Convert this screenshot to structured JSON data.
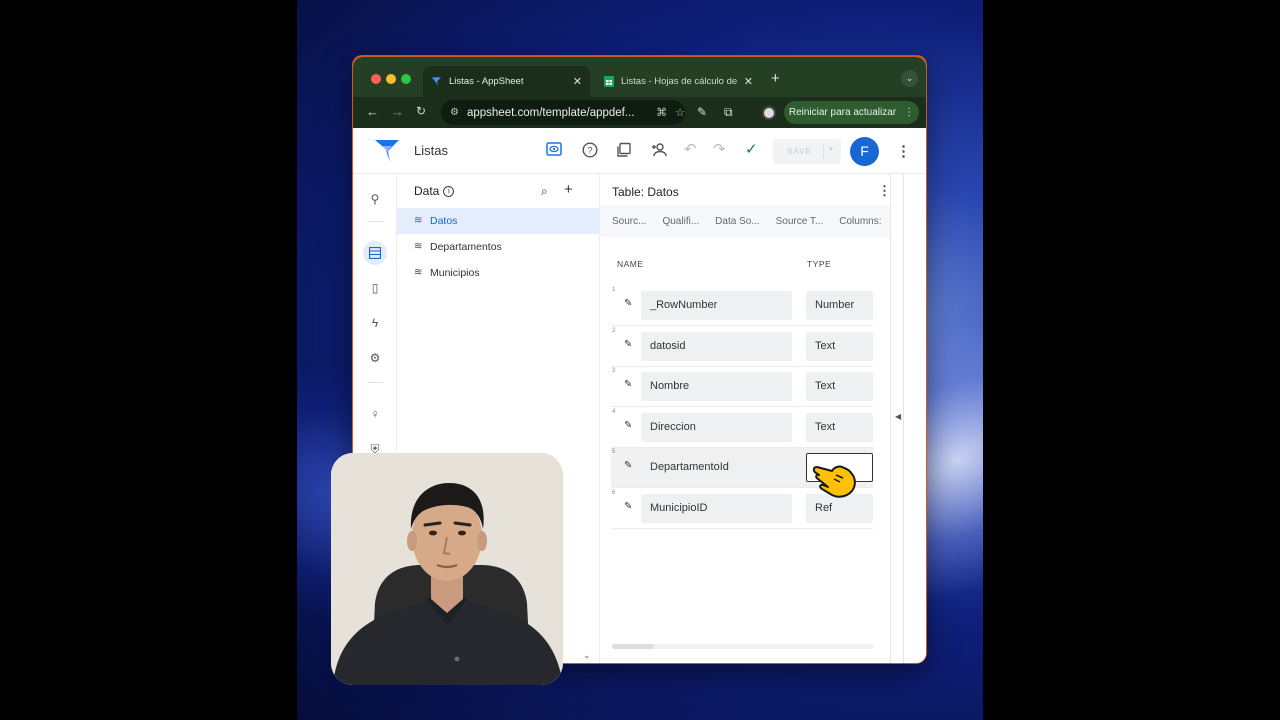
{
  "browser": {
    "tabs": [
      {
        "title": "Listas - AppSheet",
        "active": true
      },
      {
        "title": "Listas - Hojas de cálculo de G",
        "active": false
      }
    ],
    "url": "appsheet.com/template/appdef...",
    "update_button": "Reiniciar para actualizar"
  },
  "app": {
    "title": "Listas",
    "save_label": "SAVE",
    "avatar_initial": "F"
  },
  "data_panel": {
    "heading": "Data",
    "tables": [
      {
        "label": "Datos",
        "selected": true
      },
      {
        "label": "Departamentos",
        "selected": false
      },
      {
        "label": "Municipios",
        "selected": false
      }
    ]
  },
  "editor": {
    "title": "Table: Datos",
    "tabs": [
      "Sourc...",
      "Qualifi...",
      "Data So...",
      "Source T...",
      "Columns:"
    ],
    "headers": {
      "name": "NAME",
      "type": "TYPE"
    },
    "columns": [
      {
        "num": "1",
        "name": "_RowNumber",
        "type": "Number"
      },
      {
        "num": "2",
        "name": "datosid",
        "type": "Text"
      },
      {
        "num": "3",
        "name": "Nombre",
        "type": "Text"
      },
      {
        "num": "4",
        "name": "Direccion",
        "type": "Text"
      },
      {
        "num": "5",
        "name": "DepartamentoId",
        "type": ""
      },
      {
        "num": "6",
        "name": "MunicipioID",
        "type": "Ref"
      }
    ]
  },
  "colors": {
    "brand_blue": "#1967d2",
    "browser_green": "#243f24",
    "window_rim": "#e2591e"
  }
}
